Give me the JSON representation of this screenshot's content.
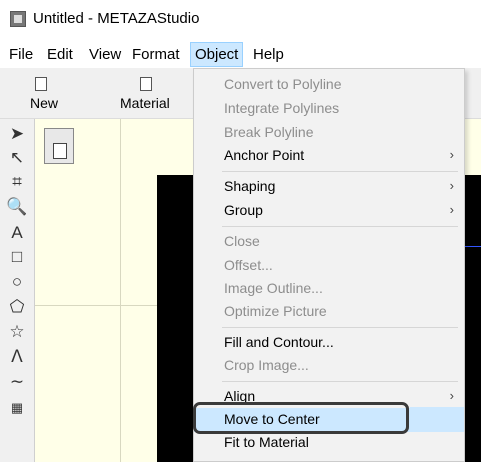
{
  "window": {
    "title": "Untitled - METAZAStudio",
    "icon": "app-icon"
  },
  "menubar": {
    "items": [
      {
        "label": "File",
        "active": false
      },
      {
        "label": "Edit",
        "active": false
      },
      {
        "label": "View",
        "active": false
      },
      {
        "label": "Format",
        "active": false
      },
      {
        "label": "Object",
        "active": true
      },
      {
        "label": "Help",
        "active": false
      }
    ]
  },
  "toolbar": {
    "buttons": [
      {
        "label": "New",
        "icon": "new-document-icon"
      },
      {
        "label": "Material",
        "icon": "material-icon"
      }
    ]
  },
  "left_tools": [
    {
      "name": "select-arrow-icon",
      "glyph": "➤"
    },
    {
      "name": "node-select-icon",
      "glyph": "↖"
    },
    {
      "name": "crop-icon",
      "glyph": "⌗"
    },
    {
      "name": "zoom-icon",
      "glyph": "🔍"
    },
    {
      "name": "text-tool-icon",
      "glyph": "A"
    },
    {
      "name": "rectangle-tool-icon",
      "glyph": "□"
    },
    {
      "name": "ellipse-tool-icon",
      "glyph": "○"
    },
    {
      "name": "polygon-tool-icon",
      "glyph": "⬠"
    },
    {
      "name": "star-tool-icon",
      "glyph": "☆"
    },
    {
      "name": "polyline-tool-icon",
      "glyph": "ᐱ"
    },
    {
      "name": "curve-tool-icon",
      "glyph": "∼"
    },
    {
      "name": "image-tool-icon",
      "glyph": "▦"
    }
  ],
  "object_menu": {
    "items": [
      {
        "label": "Convert to Polyline",
        "disabled": true,
        "submenu": false
      },
      {
        "label": "Integrate Polylines",
        "disabled": true,
        "submenu": false
      },
      {
        "label": "Break Polyline",
        "disabled": true,
        "submenu": false
      },
      {
        "label": "Anchor Point",
        "disabled": false,
        "submenu": true
      },
      {
        "label": "Shaping",
        "disabled": false,
        "submenu": true
      },
      {
        "label": "Group",
        "disabled": false,
        "submenu": true
      },
      {
        "label": "Close",
        "disabled": true,
        "submenu": false
      },
      {
        "label": "Offset...",
        "disabled": true,
        "submenu": false
      },
      {
        "label": "Image Outline...",
        "disabled": true,
        "submenu": false
      },
      {
        "label": "Optimize Picture",
        "disabled": true,
        "submenu": false
      },
      {
        "label": "Fill and Contour...",
        "disabled": false,
        "submenu": false
      },
      {
        "label": "Crop Image...",
        "disabled": true,
        "submenu": false
      },
      {
        "label": "Align",
        "disabled": false,
        "submenu": true
      },
      {
        "label": "Move to Center",
        "disabled": false,
        "submenu": false,
        "highlighted": true
      },
      {
        "label": "Fit to Material",
        "disabled": false,
        "submenu": false
      }
    ],
    "submenu_arrow": "›"
  },
  "colors": {
    "highlight": "#cce8ff",
    "menu_bg": "#f2f2f2",
    "canvas_bg": "#ffffe8",
    "disabled_text": "#8d8d8d"
  }
}
